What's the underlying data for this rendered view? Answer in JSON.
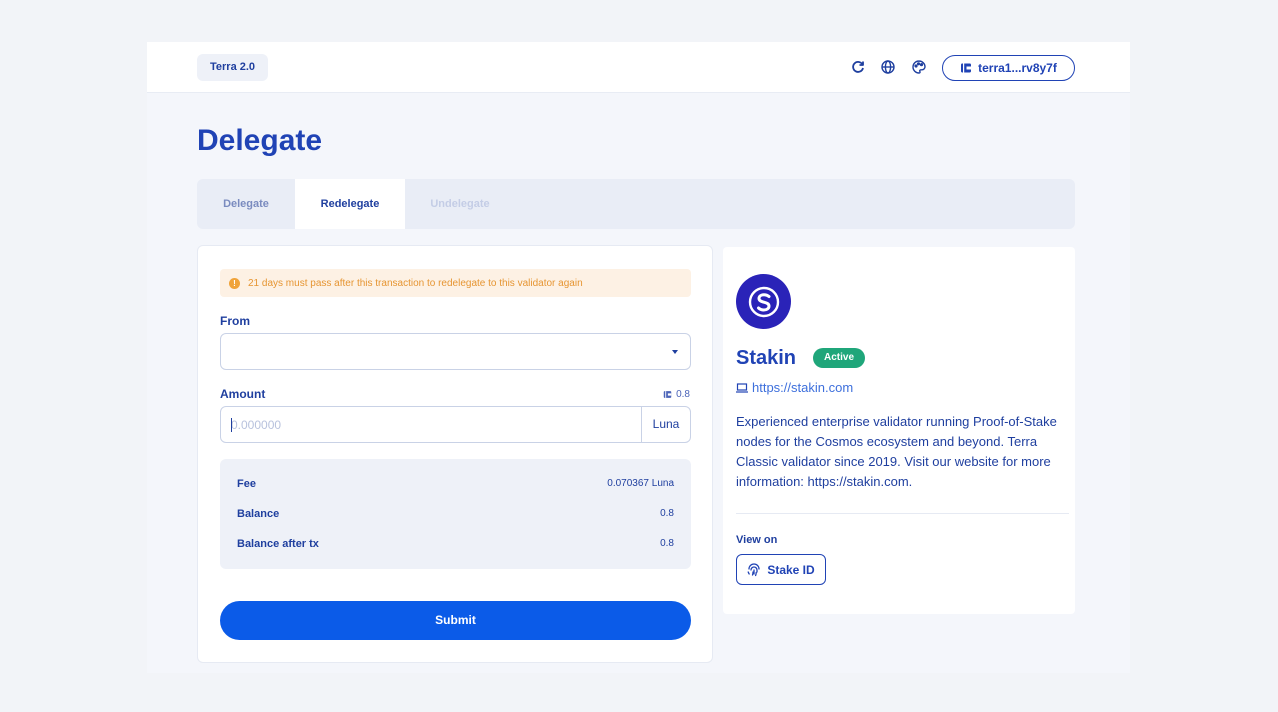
{
  "topbar": {
    "network": "Terra 2.0",
    "wallet_address": "terra1...rv8y7f",
    "icons": [
      "refresh-icon",
      "globe-icon",
      "palette-icon",
      "wallet-icon"
    ]
  },
  "page": {
    "title": "Delegate"
  },
  "tabs": [
    {
      "label": "Delegate",
      "state": "inactive"
    },
    {
      "label": "Redelegate",
      "state": "active"
    },
    {
      "label": "Undelegate",
      "state": "disabled"
    }
  ],
  "form": {
    "warning": "21 days must pass after this transaction to redelegate to this validator again",
    "from_label": "From",
    "from_value": "",
    "amount_label": "Amount",
    "available": "0.8",
    "amount_placeholder": "0.000000",
    "amount_unit": "Luna",
    "summary": {
      "fee_label": "Fee",
      "fee_value": "0.070367 Luna",
      "balance_label": "Balance",
      "balance_value": "0.8",
      "after_label": "Balance after tx",
      "after_value": "0.8"
    },
    "submit_label": "Submit"
  },
  "validator": {
    "name": "Stakin",
    "status": "Active",
    "website": "https://stakin.com",
    "description": "Experienced enterprise validator running Proof-of-Stake nodes for the Cosmos ecosystem and beyond. Terra Classic validator since 2019. Visit our website for more information: https://stakin.com.",
    "view_on_label": "View on",
    "stake_id_label": "Stake ID"
  },
  "colors": {
    "primary": "#2043b5",
    "submit": "#0b5be8",
    "active_badge": "#1fa67a",
    "warning_bg": "#fdf1e4",
    "warning_text": "#e69532"
  }
}
